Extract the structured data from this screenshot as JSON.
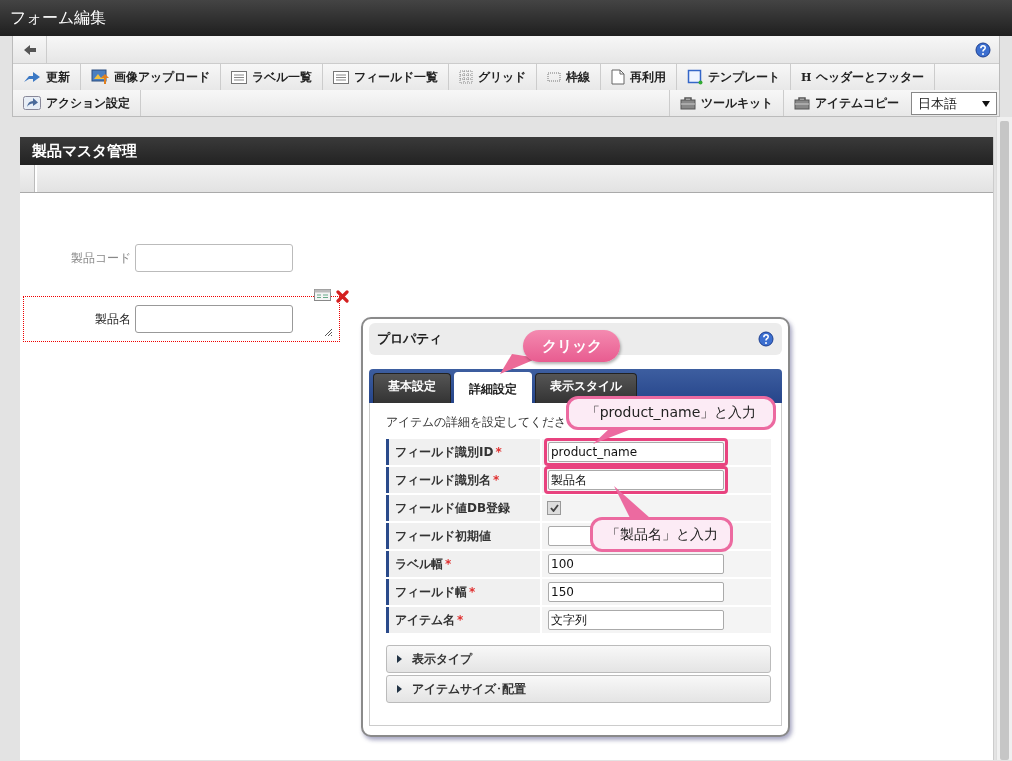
{
  "window": {
    "title": "フォーム編集"
  },
  "toolbar": {
    "row1": [
      {
        "label": "更新"
      },
      {
        "label": "画像アップロード"
      },
      {
        "label": "ラベル一覧"
      },
      {
        "label": "フィールド一覧"
      },
      {
        "label": "グリッド"
      },
      {
        "label": "枠線"
      },
      {
        "label": "再利用"
      },
      {
        "label": "テンプレート"
      },
      {
        "label": "ヘッダーとフッター",
        "glyph": "H"
      }
    ],
    "row2_left": [
      {
        "label": "アクション設定"
      }
    ],
    "row2_right": [
      {
        "label": "ツールキット"
      },
      {
        "label": "アイテムコピー"
      }
    ],
    "language": {
      "value": "日本語"
    }
  },
  "form": {
    "title": "製品マスタ管理",
    "fields": [
      {
        "label": "製品コード",
        "selected": false
      },
      {
        "label": "製品名",
        "selected": true
      }
    ]
  },
  "properties": {
    "title": "プロパティ",
    "tabs": [
      {
        "label": "基本設定",
        "selected": false
      },
      {
        "label": "詳細設定",
        "selected": true
      },
      {
        "label": "表示スタイル",
        "selected": false
      }
    ],
    "description": "アイテムの詳細を設定してくださ",
    "rows": [
      {
        "label": "フィールド識別ID",
        "required_mark": "*",
        "kind": "text",
        "value": "product_name",
        "highlighted": true
      },
      {
        "label": "フィールド識別名",
        "required_mark": "*",
        "kind": "text",
        "value": "製品名",
        "highlighted": true
      },
      {
        "label": "フィールド値DB登録",
        "kind": "checkbox",
        "checked": true
      },
      {
        "label": "フィールド初期値",
        "kind": "text",
        "highlighted": false
      },
      {
        "label": "ラベル幅",
        "required_mark": "*",
        "kind": "text",
        "value": "100",
        "highlighted": false
      },
      {
        "label": "フィールド幅",
        "required_mark": "*",
        "kind": "text",
        "value": "150",
        "highlighted": false
      },
      {
        "label": "アイテム名",
        "required_mark": "*",
        "kind": "text",
        "value": "文字列",
        "highlighted": false
      }
    ],
    "sections": [
      {
        "label": "表示タイプ",
        "expanded": false
      },
      {
        "label": "アイテムサイズ･配置",
        "expanded": false
      }
    ]
  },
  "annotations": [
    {
      "kind": "click",
      "text": "クリック"
    },
    {
      "kind": "input",
      "text": "「product_name」と入力"
    },
    {
      "kind": "input",
      "text": "「製品名」と入力"
    }
  ]
}
